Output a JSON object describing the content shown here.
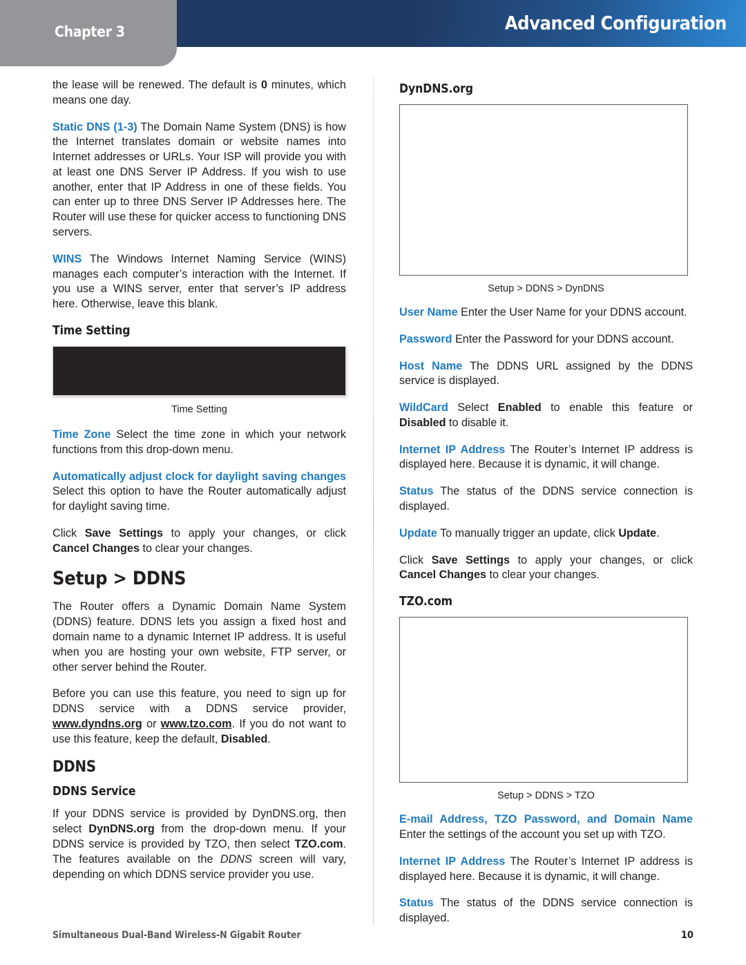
{
  "header": {
    "chapter_label": "Chapter 3",
    "title": "Advanced Configuration",
    "bar_color_start": "#1f3b63",
    "bar_color_end": "#3189cf",
    "tab_color": "#949699"
  },
  "accent_color": "#1f7ac0",
  "left_column": {
    "p_lease": {
      "t1": "the lease will be renewed. The default is ",
      "b1": "0",
      "t2": " minutes, which means one day."
    },
    "p_static_dns": {
      "k": "Static DNS (1-3)",
      "t": "  The Domain Name System (DNS) is how the Internet translates domain or website names into Internet addresses or URLs. Your ISP will provide you with at least one DNS Server IP Address. If you wish to use another, enter that IP Address in one of these fields. You can enter up to three DNS Server IP Addresses here. The Router will use these for quicker access to functioning DNS servers."
    },
    "p_wins": {
      "k": "WINS",
      "t": "  The Windows Internet Naming Service (WINS) manages each computer’s interaction with the Internet. If you use a WINS server, enter that server’s IP address here. Otherwise, leave this blank."
    },
    "h_time_setting": "Time Setting",
    "fig_time_setting_caption": "Time Setting",
    "p_time_zone": {
      "k": "Time Zone",
      "t": "  Select the time zone in which your network functions from this drop-down menu."
    },
    "p_dst": {
      "k": "Automatically adjust clock for daylight saving changes",
      "t": "  Select this option to have the Router automatically adjust for daylight saving time."
    },
    "p_save": {
      "t1": "Click ",
      "b1": "Save Settings",
      "t2": " to apply your changes, or click ",
      "b2": "Cancel Changes",
      "t3": " to clear your changes."
    },
    "h_setup_ddns": "Setup > DDNS",
    "p_ddns_intro": "The Router offers a Dynamic Domain Name System (DDNS) feature. DDNS lets you assign a fixed host and domain name to a dynamic Internet IP address. It is useful when you are hosting your own website, FTP server, or other server behind the Router.",
    "p_signup": {
      "t1": "Before you can use this feature, you need to sign up for DDNS service with a DDNS service provider, ",
      "u1": "www.dyndns.org",
      "t2": " or ",
      "u2": "www.tzo.com",
      "t3": ". If you do not want to use this feature, keep the default, ",
      "b1": "Disabled",
      "t4": "."
    },
    "h_ddns": "DDNS",
    "h_ddns_service": "DDNS Service",
    "p_ddns_service": {
      "t1": "If your DDNS service is provided by DynDNS.org, then select ",
      "b1": "DynDNS.org",
      "t2": " from the drop-down menu. If your DDNS service is provided by TZO, then select ",
      "b2": "TZO.com",
      "t3": ". The features available on the ",
      "i1": "DDNS",
      "t4": " screen will vary, depending on which DDNS service provider you use."
    }
  },
  "right_column": {
    "h_dyndns": "DynDNS.org",
    "fig_dyndns_caption": "Setup > DDNS > DynDNS",
    "p_user_name": {
      "k": "User Name",
      "t": "  Enter the User Name for your DDNS account."
    },
    "p_password": {
      "k": "Password",
      "t": "  Enter the Password for your DDNS account."
    },
    "p_host_name": {
      "k": "Host Name",
      "t": "  The DDNS URL assigned by the DDNS service is displayed."
    },
    "p_wildcard": {
      "k": "WildCard",
      "t1": " Select ",
      "b1": "Enabled",
      "t2": " to enable this feature or ",
      "b2": "Disabled",
      "t3": " to disable it."
    },
    "p_internet_ip": {
      "k": "Internet IP Address",
      "t": "  The Router’s Internet IP address is displayed here. Because it is dynamic, it will change."
    },
    "p_status": {
      "k": "Status",
      "t": " The status of the DDNS service connection is displayed."
    },
    "p_update": {
      "k": "Update",
      "t1": "  To manually trigger an update, click ",
      "b1": "Update",
      "t2": "."
    },
    "p_save": {
      "t1": "Click ",
      "b1": "Save Settings",
      "t2": " to apply your changes, or click ",
      "b2": "Cancel Changes",
      "t3": " to clear your changes."
    },
    "h_tzo": "TZO.com",
    "fig_tzo_caption": "Setup > DDNS > TZO",
    "p_email": {
      "k": "E-mail Address, TZO Password, and Domain Name",
      "t": "  Enter the settings of the account you set up with TZO."
    },
    "p_internet_ip2": {
      "k": "Internet IP Address",
      "t": "  The Router’s Internet IP address is displayed here. Because it is dynamic, it will change."
    },
    "p_status2": {
      "k": "Status",
      "t": " The status of the DDNS service connection is displayed."
    }
  },
  "footer": {
    "product": "Simultaneous Dual-Band Wireless-N Gigabit Router",
    "page_number": "10"
  }
}
